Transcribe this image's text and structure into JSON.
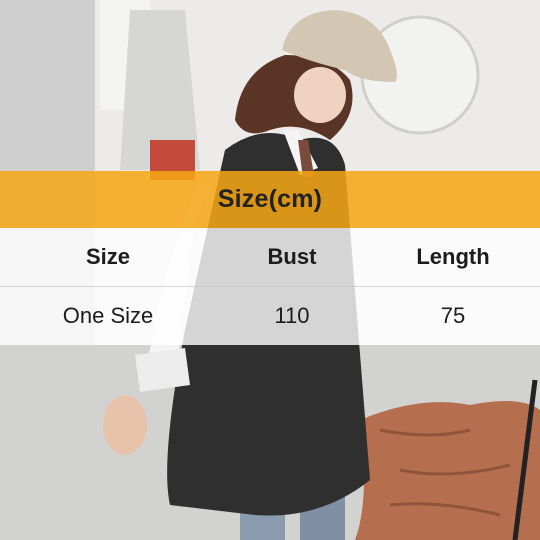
{
  "size_chart": {
    "title": "Size(cm)",
    "headers": [
      "Size",
      "Bust",
      "Length"
    ],
    "rows": [
      [
        "One Size",
        "110",
        "75"
      ]
    ]
  },
  "colors": {
    "title_band": "#f6a614",
    "table_rows": "#ffffff"
  }
}
